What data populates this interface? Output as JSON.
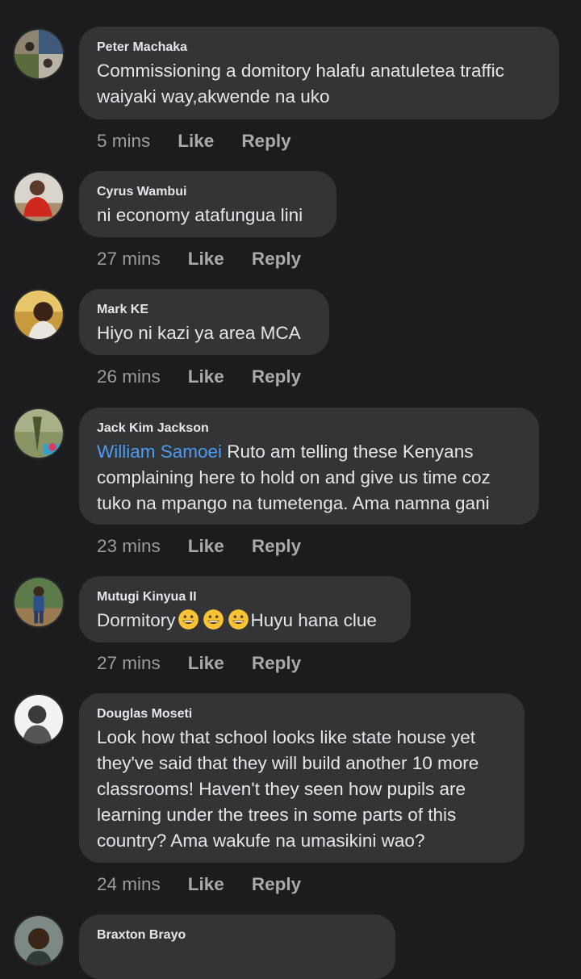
{
  "comments": [
    {
      "author": "Peter Machaka",
      "text": "Commissioning a domitory halafu anatuletea traffic\nwaiyaki way,akwende na uko",
      "time": "5 mins",
      "like": "Like",
      "reply": "Reply",
      "avatar": "avatar-peter-machaka"
    },
    {
      "author": "Cyrus Wambui",
      "text": "ni economy atafungua lini",
      "time": "27 mins",
      "like": "Like",
      "reply": "Reply",
      "avatar": "avatar-cyrus-wambui"
    },
    {
      "author": "Mark KE",
      "text": "Hiyo ni kazi ya area MCA",
      "time": "26 mins",
      "like": "Like",
      "reply": "Reply",
      "avatar": "avatar-mark-ke"
    },
    {
      "author": "Jack Kim Jackson",
      "mention": "William Samoei",
      "text": " Ruto am telling these Kenyans\ncomplaining here to hold on and give us time coz\ntuko na mpango na tumetenga. Ama namna gani",
      "time": "23 mins",
      "like": "Like",
      "reply": "Reply",
      "avatar": "avatar-jack-kim-jackson"
    },
    {
      "author": "Mutugi Kinyua II",
      "text_before": "Dormitory",
      "text_after": "Huyu hana clue",
      "emoji": "grinning-face-emoji",
      "time": "27 mins",
      "like": "Like",
      "reply": "Reply",
      "avatar": "avatar-mutugi-kinyua"
    },
    {
      "author": "Douglas Moseti",
      "text": "Look how that school looks like state house yet\nthey've said that they will build another 10 more\nclassrooms! Haven't they seen how pupils are\nlearning under the trees in some parts of this\ncountry? Ama wakufe na umasikini wao?",
      "time": "24 mins",
      "like": "Like",
      "reply": "Reply",
      "avatar": "avatar-douglas-moseti"
    },
    {
      "author": "Braxton Brayo",
      "avatar": "avatar-braxton-brayo"
    }
  ],
  "colors": {
    "background": "#1c1c1e",
    "bubble": "#333436",
    "mention": "#4e9cf5",
    "meta": "#a8aaae"
  }
}
